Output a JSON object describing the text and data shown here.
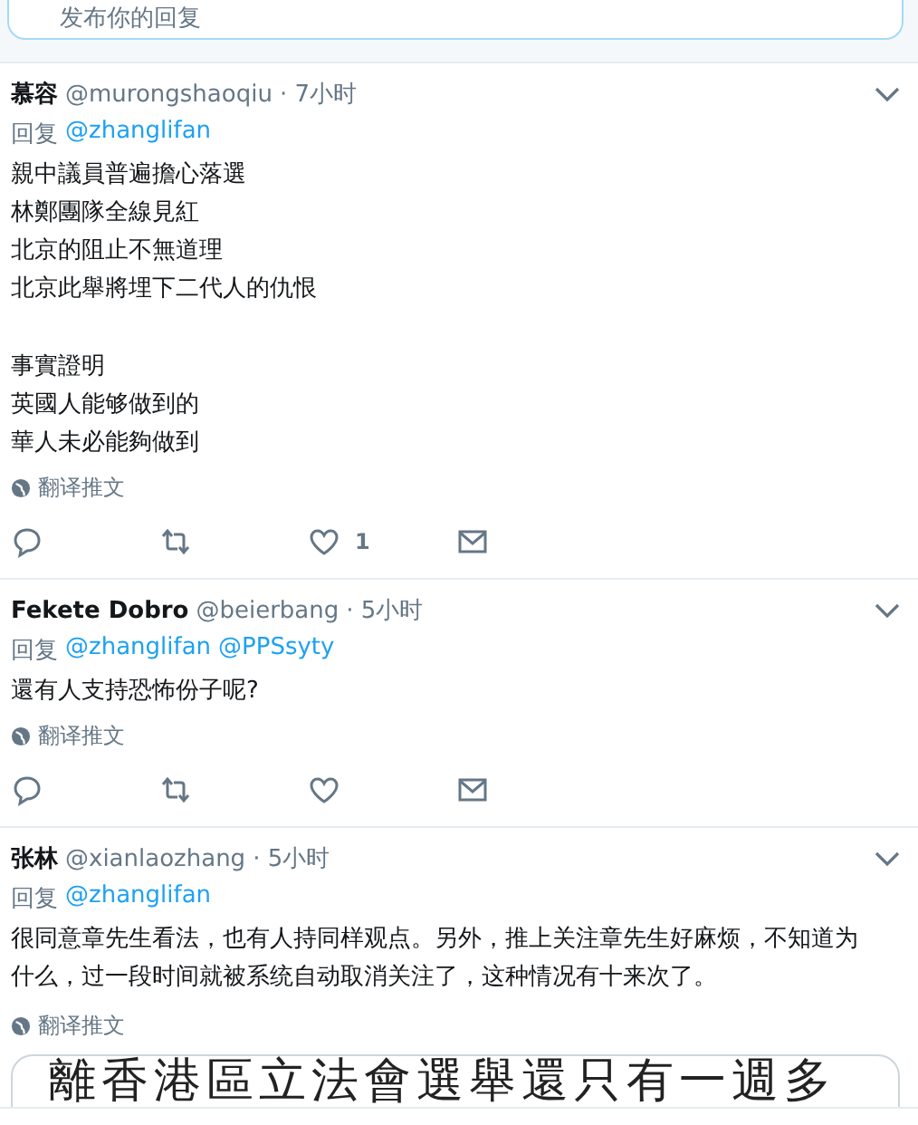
{
  "reply_box": {
    "placeholder": "发布你的回复"
  },
  "tweets": [
    {
      "name": "慕容",
      "handle": "@murongshaoqiu",
      "time": "· 7小时",
      "reply_label": "回复",
      "reply_to": [
        "@zhanglifan"
      ],
      "paragraphs": [
        [
          "親中議員普遍擔心落選",
          "林鄭團隊全線見紅",
          "北京的阻止不無道理",
          "北京此舉將埋下二代人的仇恨"
        ],
        [
          "事實證明",
          "英國人能够做到的",
          "華人未必能夠做到"
        ]
      ],
      "translate": "翻译推文",
      "actions": true,
      "like_count": "1"
    },
    {
      "name": "Fekete Dobro",
      "handle": "@beierbang",
      "time": "· 5小时",
      "reply_label": "回复",
      "reply_to": [
        "@zhanglifan",
        "@PPSsyty"
      ],
      "paragraphs": [
        [
          "還有人支持恐怖份子呢?"
        ]
      ],
      "translate": "翻译推文",
      "actions": true
    },
    {
      "name": "张林",
      "handle": "@xianlaozhang",
      "time": "· 5小时",
      "reply_label": "回复",
      "reply_to": [
        "@zhanglifan"
      ],
      "paragraphs": [
        [
          "很同意章先生看法，也有人持同样观点。另外，推上关注章先生好麻烦，不知道为什么，过一段时间就被系统自动取消关注了，这种情况有十来次了。"
        ]
      ],
      "translate": "翻译推文",
      "media": {
        "text": "離香港區立法會選舉還只有一週多"
      }
    }
  ]
}
